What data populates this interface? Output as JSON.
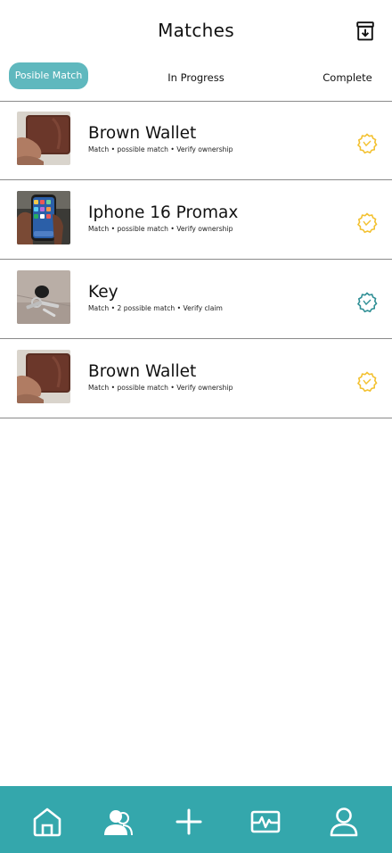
{
  "header": {
    "title": "Matches",
    "archive_icon": "archive-download-icon"
  },
  "tabs": [
    {
      "label": "Posible Match",
      "active": true
    },
    {
      "label": "In Progress",
      "active": false
    },
    {
      "label": "Complete",
      "active": false
    }
  ],
  "items": [
    {
      "title": "Brown Wallet",
      "meta": "Match • possible match • Verify ownership",
      "image": "brown-wallet",
      "badge_color": "#f3c130"
    },
    {
      "title": "Iphone 16 Promax",
      "meta": "Match • possible match • Verify ownership",
      "image": "iphone",
      "badge_color": "#f3c130"
    },
    {
      "title": "Key",
      "meta": "Match • 2 possible match • Verify claim",
      "image": "key",
      "badge_color": "#2f8f95"
    },
    {
      "title": "Brown Wallet",
      "meta": "Match • possible match • Verify ownership",
      "image": "brown-wallet",
      "badge_color": "#f3c130"
    }
  ],
  "bottom_nav": {
    "background": "#34a7ac",
    "items": [
      {
        "icon": "home-icon"
      },
      {
        "icon": "users-icon"
      },
      {
        "icon": "plus-icon"
      },
      {
        "icon": "activity-icon"
      },
      {
        "icon": "profile-icon"
      }
    ]
  },
  "colors": {
    "accent": "#5fb8be",
    "nav": "#34a7ac",
    "badge_pending": "#f3c130",
    "badge_verify": "#2f8f95"
  }
}
